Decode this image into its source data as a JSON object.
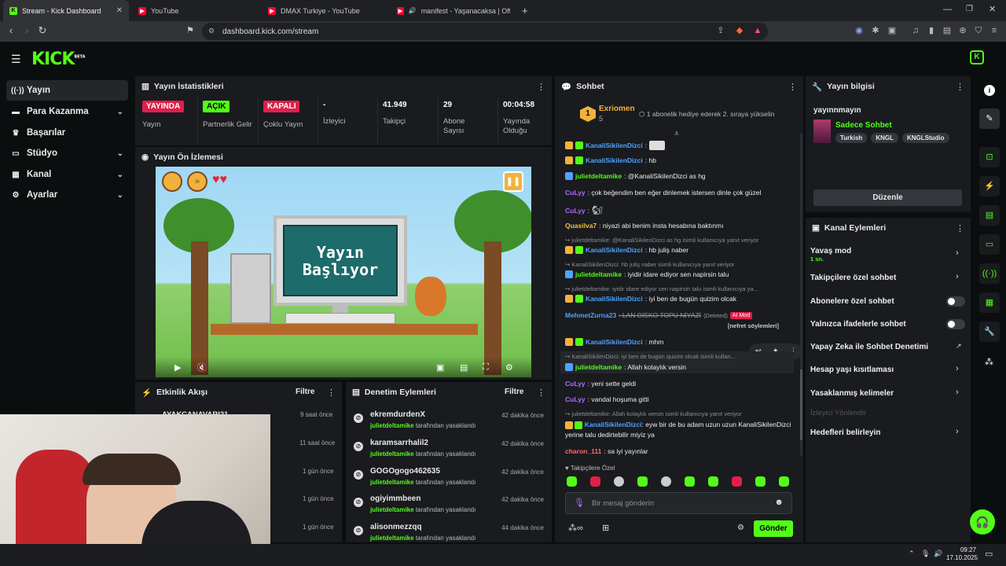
{
  "browser": {
    "tabs": [
      {
        "title": "Stream - Kick Dashboard",
        "active": true,
        "icon": "kick-favicon"
      },
      {
        "title": "YouTube",
        "active": false,
        "icon": "youtube-favicon"
      },
      {
        "title": "DMAX Turkiye - YouTube",
        "active": false,
        "icon": "youtube-favicon"
      },
      {
        "title": "manifest - Yaşanacaksa | Official",
        "active": false,
        "icon": "youtube-favicon"
      }
    ],
    "url": "dashboard.kick.com/stream"
  },
  "brand": {
    "logo": "KICK",
    "beta": "BETA",
    "accent": "#53fc18"
  },
  "sidebar": {
    "items": [
      {
        "label": "Yayın",
        "icon": "broadcast-icon"
      },
      {
        "label": "Para Kazanma",
        "icon": "money-icon"
      },
      {
        "label": "Başarılar",
        "icon": "trophy-icon"
      },
      {
        "label": "Stüdyo",
        "icon": "studio-icon"
      },
      {
        "label": "Kanal",
        "icon": "channel-icon"
      },
      {
        "label": "Ayarlar",
        "icon": "gear-icon"
      }
    ]
  },
  "stats": {
    "title": "Yayın İstatistikleri",
    "items": [
      {
        "value": "YAYINDA",
        "label": "Yayın"
      },
      {
        "value": "AÇIK",
        "label": "Partnerlik Gelir"
      },
      {
        "value": "KAPALI",
        "label": "Çoklu Yayın"
      },
      {
        "value": "-",
        "label": "İzleyici"
      },
      {
        "value": "41.949",
        "label": "Takipçi"
      },
      {
        "value": "29",
        "label": "Abone Sayısı"
      },
      {
        "value": "00:04:58",
        "label": "Yayında Olduğu"
      }
    ]
  },
  "preview": {
    "title": "Yayın Ön İzlemesi",
    "screen_text": "Yayın Başlıyor"
  },
  "activity": {
    "title": "Etkinlik Akışı",
    "filter": "Filtre",
    "items": [
      {
        "name": "AYAKCANAVARI21",
        "time": "9 saat önce"
      },
      {
        "name": "",
        "time": "11 saat önce"
      },
      {
        "name": "",
        "time": "1 gün önce"
      },
      {
        "name": "",
        "time": "1 gün önce"
      },
      {
        "name": "",
        "time": "1 gün önce"
      }
    ]
  },
  "moderation": {
    "title": "Denetim Eylemleri",
    "filter": "Filtre",
    "suffix": "tarafından yasaklandı",
    "items": [
      {
        "name": "ekremdurdenX",
        "by": "julietdeltamike",
        "time": "42 dakika önce"
      },
      {
        "name": "karamsarrhalil2",
        "by": "julietdeltamike",
        "time": "42 dakika önce"
      },
      {
        "name": "GOGOgogo462635",
        "by": "julietdeltamike",
        "time": "42 dakika önce"
      },
      {
        "name": "ogiyimmbeen",
        "by": "julietdeltamike",
        "time": "42 dakika önce"
      },
      {
        "name": "alisonmezzqq",
        "by": "julietdeltamike",
        "time": "44 dakika önce"
      }
    ]
  },
  "chat": {
    "title": "Sohbet",
    "pinned": {
      "user": "Exriomen",
      "count": "5",
      "text": "1 abonelik hediye ederek 2. sıraya yükselin"
    },
    "messages": [
      {
        "user": "KanaliSikilenDizci",
        "color": "#4fa3ff",
        "text": ":"
      },
      {
        "user": "KanaliSikilenDizci",
        "color": "#4fa3ff",
        "text": ": hb"
      },
      {
        "user": "julietdeltamike",
        "color": "#53fc18",
        "text": ": @KanaliSikilenDizci as hg"
      },
      {
        "user": "CuLyy",
        "color": "#b06cff",
        "text": ": çok beğendim ben eğer dinlemek istersen dinle çok güzel"
      },
      {
        "user": "CuLyy",
        "color": "#b06cff",
        "text": ":"
      },
      {
        "user": "Quasilva7",
        "color": "#f0c040",
        "text": ": niyazi abi benim insta hesabına baktınmı"
      },
      {
        "reply": "julietdeltamike: @KanaliSikilenDizci as hg isimli kullanıcıya yanıt veriyor",
        "user": "KanaliSikilenDizci",
        "color": "#4fa3ff",
        "text": ": hb juliş naber"
      },
      {
        "reply": "KanaliSikilenDizci: hb juliş naber isimli kullanıcıya yanıt veriyor",
        "user": "julietdeltamike",
        "color": "#53fc18",
        "text": ": iyidir idare ediyor sen napirsin talu"
      },
      {
        "reply": "julietdeltamike: iyidir idare ediyor sen napirsin talu isimli kullanıcıya ya...",
        "user": "KanaliSikilenDizci",
        "color": "#4fa3ff",
        "text": ": iyi ben de bugün quizim olcak"
      },
      {
        "user": "MehmetZurna23",
        "color": "#4fa3ff",
        "text": ": LAN DİSKO TOPU NİYAZİ",
        "deleted": "(Deleted)",
        "tag": "AI Mod",
        "note": "[nefret söylemleri]"
      },
      {
        "user": "KanaliSikilenDizci",
        "color": "#4fa3ff",
        "text": ": mhm"
      },
      {
        "reply": "KanaliSikilenDizci: iyi ben de bugün quizim olcak isimli kullan...",
        "user": "julietdeltamike",
        "color": "#53fc18",
        "text": ": Allah kolaylık versin"
      },
      {
        "user": "CuLyy",
        "color": "#b06cff",
        "text": ": yeni sette geldi"
      },
      {
        "user": "CuLyy",
        "color": "#b06cff",
        "text": ": vandal hoşuma gitti"
      },
      {
        "reply": "julietdeltamike: Allah kolaylık versin isimli kullanıcıya yanıt veriyor",
        "user": "KanaliSikilenDizci",
        "color": "#4fa3ff",
        "text": ": eyw bir de bu adam uzun uzun KanaliSikilenDizci yerine talu dedirtebilir miyiz ya"
      },
      {
        "user": "charon_111",
        "color": "#ff6b6b",
        "text": ": sa iyi yayınlar"
      }
    ],
    "followers_only": "Takipçilere Özel",
    "input_placeholder": "Bir mesaj gönderin",
    "send": "Gönder"
  },
  "stream_info": {
    "title": "Yayın bilgisi",
    "stream_title": "yayınnmayın",
    "category": "Sadece Sohbet",
    "tags": [
      "Turkish",
      "KNGL",
      "KNGLStudio"
    ],
    "edit": "Düzenle"
  },
  "channel_actions": {
    "title": "Kanal Eylemleri",
    "slow_mode": "Yavaş mod",
    "slow_value": "1 sn.",
    "items": [
      {
        "label": "Takipçilere özel sohbet",
        "type": "arrow"
      },
      {
        "label": "Abonelere özel sohbet",
        "type": "toggle"
      },
      {
        "label": "Yalnızca ifadelerle sohbet",
        "type": "toggle"
      },
      {
        "label": "Yapay Zeka ile Sohbet Denetimi",
        "type": "external"
      },
      {
        "label": "Hesap yaşı kısıtlaması",
        "type": "arrow"
      },
      {
        "label": "Yasaklanmış kelimeler",
        "type": "arrow"
      }
    ],
    "disabled": "İzleyici Yönlendir",
    "goals": "Hedefleri belirleyin"
  },
  "taskbar": {
    "time": "09:27",
    "date": "17.10.2025"
  }
}
